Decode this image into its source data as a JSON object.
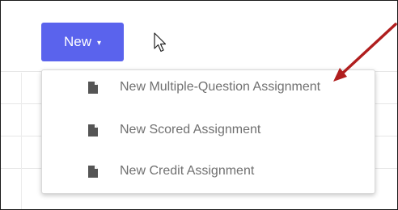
{
  "toolbar": {
    "new_label": "New",
    "caret": "▾",
    "button_color": "#5a63ed"
  },
  "dropdown": {
    "items": [
      {
        "label": "New Multiple-Question Assignment",
        "icon": "document-icon"
      },
      {
        "label": "New Scored Assignment",
        "icon": "document-icon"
      },
      {
        "label": "New Credit Assignment",
        "icon": "document-icon"
      }
    ]
  },
  "annotation": {
    "arrow_color": "#b01e1e"
  }
}
